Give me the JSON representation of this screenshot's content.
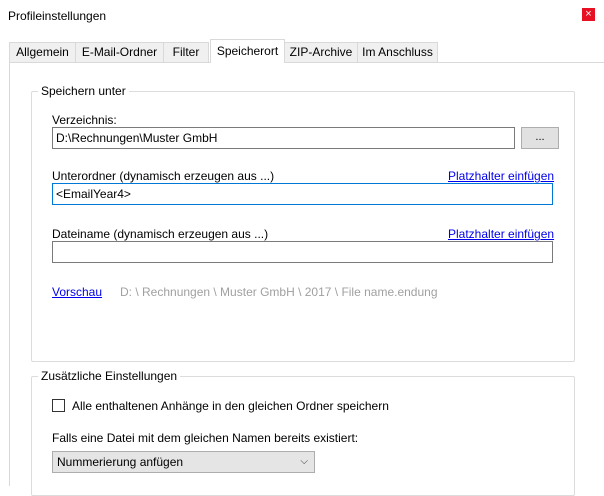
{
  "window": {
    "title": "Profileinstellungen",
    "close_glyph": "×"
  },
  "tabs": [
    {
      "label": "Allgemein"
    },
    {
      "label": "E-Mail-Ordner"
    },
    {
      "label": "Filter"
    },
    {
      "label": "Speicherort",
      "active": true
    },
    {
      "label": "ZIP-Archive"
    },
    {
      "label": "Im Anschluss"
    }
  ],
  "save_group": {
    "legend": "Speichern unter",
    "directory_label": "Verzeichnis:",
    "directory_value": "D:\\Rechnungen\\Muster GmbH",
    "browse_label": "...",
    "subfolder_label": "Unterordner (dynamisch erzeugen aus ...)",
    "subfolder_link": "Platzhalter einfügen",
    "subfolder_value": "<EmailYear4>",
    "filename_label": "Dateiname (dynamisch erzeugen aus ...)",
    "filename_link": "Platzhalter einfügen",
    "filename_value": "",
    "preview_link": "Vorschau",
    "preview_text": "D: \\ Rechnungen \\ Muster GmbH \\ 2017 \\ File name.endung"
  },
  "extra_group": {
    "legend": "Zusätzliche Einstellungen",
    "same_folder_checkbox_label": "Alle enthaltenen Anhänge in den gleichen Ordner speichern",
    "same_folder_checked": false,
    "exists_label": "Falls eine Datei mit dem gleichen Namen bereits existiert:",
    "exists_select_value": "Nummerierung anfügen"
  },
  "colors": {
    "link": "#0000ee",
    "focus_border": "#0078d7",
    "close_bg": "#e81123"
  }
}
